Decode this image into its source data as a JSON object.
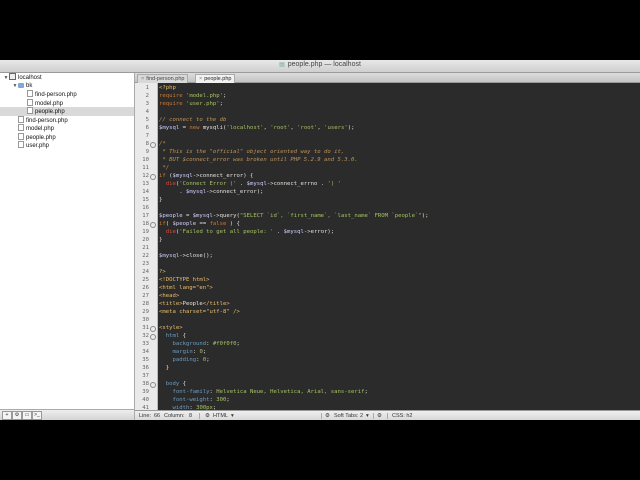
{
  "window": {
    "title": "people.php — localhost"
  },
  "sidebar": {
    "tree": [
      {
        "label": "localhost",
        "level": 0,
        "icon": "server-icon",
        "twisty": "▼",
        "selected": false
      },
      {
        "label": "bk",
        "level": 1,
        "icon": "folder-icon",
        "twisty": "▼",
        "selected": false
      },
      {
        "label": "find-person.php",
        "level": 2,
        "icon": "file-icon",
        "twisty": "",
        "selected": false
      },
      {
        "label": "model.php",
        "level": 2,
        "icon": "file-icon",
        "twisty": "",
        "selected": false
      },
      {
        "label": "people.php",
        "level": 2,
        "icon": "file-icon",
        "twisty": "",
        "selected": true
      },
      {
        "label": "find-person.php",
        "level": 1,
        "icon": "file-icon",
        "twisty": "",
        "selected": false
      },
      {
        "label": "model.php",
        "level": 1,
        "icon": "file-icon",
        "twisty": "",
        "selected": false
      },
      {
        "label": "people.php",
        "level": 1,
        "icon": "file-icon",
        "twisty": "",
        "selected": false
      },
      {
        "label": "user.php",
        "level": 1,
        "icon": "file-icon",
        "twisty": "",
        "selected": false
      }
    ],
    "footer_buttons": [
      {
        "name": "add-file-button",
        "glyph": "+"
      },
      {
        "name": "gear-button",
        "glyph": "⚙"
      },
      {
        "name": "folder-button",
        "glyph": "▭"
      },
      {
        "name": "terminal-button",
        "glyph": ">_"
      }
    ]
  },
  "tabs": [
    {
      "label": "find-person.php",
      "active": false
    },
    {
      "label": "people.php",
      "active": true
    }
  ],
  "editor": {
    "lines": [
      {
        "n": "1",
        "fold": false,
        "tokens": [
          [
            "tag",
            "<?php"
          ]
        ]
      },
      {
        "n": "2",
        "fold": false,
        "tokens": [
          [
            "kw",
            "require"
          ],
          [
            "def",
            " "
          ],
          [
            "str",
            "'model.php'"
          ],
          [
            "def",
            ";"
          ]
        ]
      },
      {
        "n": "3",
        "fold": false,
        "tokens": [
          [
            "kw",
            "require"
          ],
          [
            "def",
            " "
          ],
          [
            "str",
            "'user.php'"
          ],
          [
            "def",
            ";"
          ]
        ]
      },
      {
        "n": "4",
        "fold": false,
        "tokens": []
      },
      {
        "n": "5",
        "fold": false,
        "tokens": [
          [
            "cm",
            "// connect to the db"
          ]
        ]
      },
      {
        "n": "6",
        "fold": false,
        "tokens": [
          [
            "var",
            "$mysql"
          ],
          [
            "def",
            " = "
          ],
          [
            "kw",
            "new"
          ],
          [
            "def",
            " mysqli("
          ],
          [
            "str",
            "'localhost'"
          ],
          [
            "def",
            ", "
          ],
          [
            "str",
            "'root'"
          ],
          [
            "def",
            ", "
          ],
          [
            "str",
            "'root'"
          ],
          [
            "def",
            ", "
          ],
          [
            "str",
            "'users'"
          ],
          [
            "def",
            ");"
          ]
        ]
      },
      {
        "n": "7",
        "fold": false,
        "tokens": []
      },
      {
        "n": "8",
        "fold": true,
        "tokens": [
          [
            "cm",
            "/*"
          ]
        ]
      },
      {
        "n": "9",
        "fold": false,
        "tokens": [
          [
            "cm",
            " * This is the \"official\" object oriented way to do it,"
          ]
        ]
      },
      {
        "n": "10",
        "fold": false,
        "tokens": [
          [
            "cm",
            " * BUT $connect_error was broken until PHP 5.2.9 and 5.3.0."
          ]
        ]
      },
      {
        "n": "11",
        "fold": false,
        "tokens": [
          [
            "cm",
            " */"
          ]
        ]
      },
      {
        "n": "12",
        "fold": true,
        "tokens": [
          [
            "kw",
            "if"
          ],
          [
            "def",
            " ("
          ],
          [
            "var",
            "$mysql"
          ],
          [
            "def",
            "->connect_error) {"
          ]
        ]
      },
      {
        "n": "13",
        "fold": false,
        "tokens": [
          [
            "def",
            "  "
          ],
          [
            "fn",
            "die"
          ],
          [
            "def",
            "("
          ],
          [
            "str",
            "'Connect Error ('"
          ],
          [
            "def",
            " . "
          ],
          [
            "var",
            "$mysql"
          ],
          [
            "def",
            "->connect_errno . "
          ],
          [
            "str",
            "') '"
          ]
        ]
      },
      {
        "n": "14",
        "fold": false,
        "tokens": [
          [
            "def",
            "      . "
          ],
          [
            "var",
            "$mysql"
          ],
          [
            "def",
            "->connect_error);"
          ]
        ]
      },
      {
        "n": "15",
        "fold": false,
        "tokens": [
          [
            "def",
            "}"
          ]
        ]
      },
      {
        "n": "16",
        "fold": false,
        "tokens": []
      },
      {
        "n": "17",
        "fold": false,
        "tokens": [
          [
            "var",
            "$people"
          ],
          [
            "def",
            " = "
          ],
          [
            "var",
            "$mysql"
          ],
          [
            "def",
            "->query("
          ],
          [
            "str",
            "\"SELECT `id`, `first_name`, `last_name` FROM `people`\""
          ],
          [
            "def",
            ");"
          ]
        ]
      },
      {
        "n": "18",
        "fold": true,
        "tokens": [
          [
            "kw",
            "if"
          ],
          [
            "def",
            "( "
          ],
          [
            "var",
            "$people"
          ],
          [
            "def",
            " == "
          ],
          [
            "kw",
            "false"
          ],
          [
            "def",
            " ) {"
          ]
        ]
      },
      {
        "n": "19",
        "fold": false,
        "tokens": [
          [
            "def",
            "  "
          ],
          [
            "fn",
            "die"
          ],
          [
            "def",
            "("
          ],
          [
            "str",
            "'Failed to get all people: '"
          ],
          [
            "def",
            " . "
          ],
          [
            "var",
            "$mysql"
          ],
          [
            "def",
            "->error);"
          ]
        ]
      },
      {
        "n": "20",
        "fold": false,
        "tokens": [
          [
            "def",
            "}"
          ]
        ]
      },
      {
        "n": "21",
        "fold": false,
        "tokens": []
      },
      {
        "n": "22",
        "fold": false,
        "tokens": [
          [
            "var",
            "$mysql"
          ],
          [
            "def",
            "->close();"
          ]
        ]
      },
      {
        "n": "23",
        "fold": false,
        "tokens": []
      },
      {
        "n": "24",
        "fold": false,
        "tokens": [
          [
            "tag",
            "?>"
          ]
        ]
      },
      {
        "n": "25",
        "fold": false,
        "tokens": [
          [
            "tag",
            "<!DOCTYPE html>"
          ]
        ]
      },
      {
        "n": "26",
        "fold": false,
        "tokens": [
          [
            "tag",
            "<html lang=\"en\">"
          ]
        ]
      },
      {
        "n": "27",
        "fold": false,
        "tokens": [
          [
            "tag",
            "<head>"
          ]
        ]
      },
      {
        "n": "28",
        "fold": false,
        "tokens": [
          [
            "tag",
            "<title>"
          ],
          [
            "def",
            "People"
          ],
          [
            "tag",
            "</title>"
          ]
        ]
      },
      {
        "n": "29",
        "fold": false,
        "tokens": [
          [
            "tag",
            "<meta charset=\"utf-8\" />"
          ]
        ]
      },
      {
        "n": "30",
        "fold": false,
        "tokens": []
      },
      {
        "n": "31",
        "fold": true,
        "tokens": [
          [
            "tag",
            "<style>"
          ]
        ]
      },
      {
        "n": "32",
        "fold": true,
        "tokens": [
          [
            "def",
            "  "
          ],
          [
            "css",
            "html"
          ],
          [
            "def",
            " {"
          ]
        ]
      },
      {
        "n": "33",
        "fold": false,
        "tokens": [
          [
            "def",
            "    "
          ],
          [
            "css",
            "background"
          ],
          [
            "def",
            ": "
          ],
          [
            "str",
            "#f0f0f0"
          ],
          [
            "def",
            ";"
          ]
        ]
      },
      {
        "n": "34",
        "fold": false,
        "tokens": [
          [
            "def",
            "    "
          ],
          [
            "css",
            "margin"
          ],
          [
            "def",
            ": "
          ],
          [
            "str",
            "0"
          ],
          [
            "def",
            ";"
          ]
        ]
      },
      {
        "n": "35",
        "fold": false,
        "tokens": [
          [
            "def",
            "    "
          ],
          [
            "css",
            "padding"
          ],
          [
            "def",
            ": "
          ],
          [
            "str",
            "0"
          ],
          [
            "def",
            ";"
          ]
        ]
      },
      {
        "n": "36",
        "fold": false,
        "tokens": [
          [
            "def",
            "  }"
          ]
        ]
      },
      {
        "n": "37",
        "fold": false,
        "tokens": []
      },
      {
        "n": "38",
        "fold": true,
        "tokens": [
          [
            "def",
            "  "
          ],
          [
            "css",
            "body"
          ],
          [
            "def",
            " {"
          ]
        ]
      },
      {
        "n": "39",
        "fold": false,
        "tokens": [
          [
            "def",
            "    "
          ],
          [
            "css",
            "font-family"
          ],
          [
            "def",
            ": "
          ],
          [
            "str",
            "Helvetica Neue, Helvetica, Arial, sans-serif"
          ],
          [
            "def",
            ";"
          ]
        ]
      },
      {
        "n": "40",
        "fold": false,
        "tokens": [
          [
            "def",
            "    "
          ],
          [
            "css",
            "font-weight"
          ],
          [
            "def",
            ": "
          ],
          [
            "str",
            "300"
          ],
          [
            "def",
            ";"
          ]
        ]
      },
      {
        "n": "41",
        "fold": false,
        "tokens": [
          [
            "def",
            "    "
          ],
          [
            "css",
            "width"
          ],
          [
            "def",
            ": "
          ],
          [
            "str",
            "300px"
          ],
          [
            "def",
            ";"
          ]
        ]
      }
    ]
  },
  "statusbar": {
    "line_label": "Line:",
    "line_value": "66",
    "column_label": "Column:",
    "column_value": "8",
    "language": "HTML",
    "soft_tabs_label": "Soft Tabs:",
    "soft_tabs_value": "2",
    "symbol": "CSS: h2"
  },
  "colors": {
    "editor_bg": "#2b2b2b",
    "keyword": "#cc7833",
    "string": "#a5c261",
    "comment": "#bc9458",
    "tag": "#e8bf6a"
  }
}
